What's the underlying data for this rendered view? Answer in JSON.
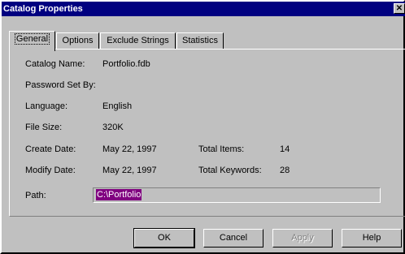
{
  "window": {
    "title": "Catalog Properties",
    "close_glyph": "✕"
  },
  "tabs": [
    {
      "label": "General",
      "active": true
    },
    {
      "label": "Options",
      "active": false
    },
    {
      "label": "Exclude Strings",
      "active": false
    },
    {
      "label": "Statistics",
      "active": false
    }
  ],
  "fields": {
    "catalog_name": {
      "label": "Catalog Name:",
      "value": "Portfolio.fdb"
    },
    "password_set_by": {
      "label": "Password Set By:",
      "value": ""
    },
    "language": {
      "label": "Language:",
      "value": "English"
    },
    "file_size": {
      "label": "File Size:",
      "value": "320K"
    },
    "create_date": {
      "label": "Create Date:",
      "value": "May 22, 1997"
    },
    "modify_date": {
      "label": "Modify Date:",
      "value": "May 22, 1997"
    },
    "total_items": {
      "label": "Total Items:",
      "value": "14"
    },
    "total_keywords": {
      "label": "Total Keywords:",
      "value": "28"
    },
    "path": {
      "label": "Path:",
      "value": "C:\\Portfolio"
    }
  },
  "buttons": {
    "ok": "OK",
    "cancel": "Cancel",
    "apply": "Apply",
    "help": "Help"
  }
}
